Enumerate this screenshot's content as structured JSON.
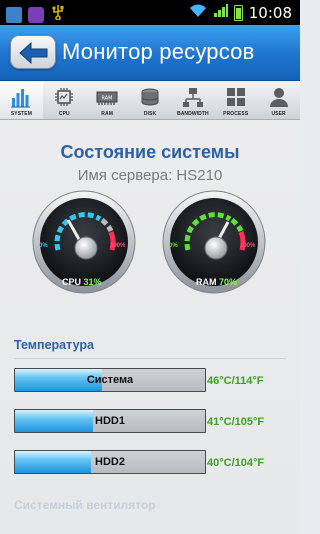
{
  "status_bar": {
    "time": "10:08",
    "icons": [
      "gallery-icon",
      "app-icon",
      "usb-icon",
      "wifi-icon",
      "signal-icon",
      "battery-icon"
    ]
  },
  "header": {
    "back_icon": "arrow-left-icon",
    "title": "Монитор ресурсов"
  },
  "tabs": [
    {
      "label": "SYSTEM",
      "icon": "bar-chart-icon",
      "active": true
    },
    {
      "label": "CPU",
      "icon": "cpu-chip-icon",
      "active": false
    },
    {
      "label": "RAM",
      "icon": "ram-module-icon",
      "active": false
    },
    {
      "label": "DISK",
      "icon": "disk-icon",
      "active": false
    },
    {
      "label": "BANDWIDTH",
      "icon": "network-icon",
      "active": false
    },
    {
      "label": "PROCESS",
      "icon": "process-grid-icon",
      "active": false
    },
    {
      "label": "USER",
      "icon": "user-icon",
      "active": false
    }
  ],
  "system": {
    "heading": "Состояние системы",
    "server": "Имя сервера: HS210"
  },
  "gauges": {
    "cpu": {
      "label": "CPU",
      "value_text": "31%",
      "value": 31,
      "min_label": "0%",
      "max_label": "100%"
    },
    "ram": {
      "label": "RAM",
      "value_text": "70%",
      "value": 70,
      "min_label": "0%",
      "max_label": "100%"
    }
  },
  "temperature": {
    "title": "Температура",
    "items": [
      {
        "name": "Система",
        "level": 0.46,
        "value": "46°C/114°F"
      },
      {
        "name": "HDD1",
        "level": 0.41,
        "value": "41°C/105°F"
      },
      {
        "name": "HDD2",
        "level": 0.4,
        "value": "40°C/104°F"
      }
    ]
  },
  "next_section": "Системный вентилятор",
  "colors": {
    "header_blue": "#1f74cf",
    "heading_blue": "#2b61a7",
    "temp_green": "#3aa31c",
    "gauge_value": "#7cff5a",
    "cpu_arc": "#35c7f2",
    "ram_arc": "#5fe034",
    "gauge_red": "#ff2f5a"
  }
}
